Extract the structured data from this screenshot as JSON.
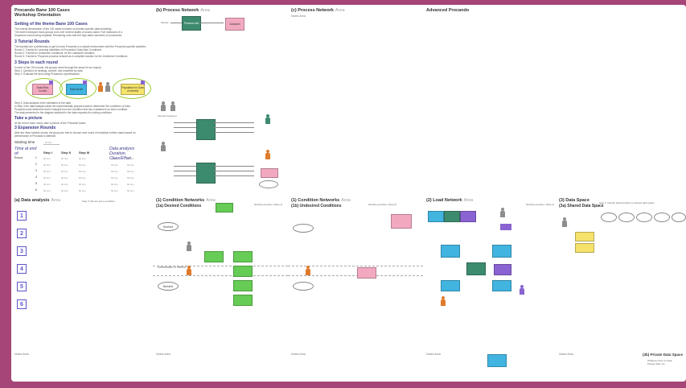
{
  "colors": {
    "frame": "#a64577",
    "board": "#e7e7ea",
    "panel": "#ffffff",
    "accent_purple": "#5c55c8",
    "blue": "#41b4e0",
    "green": "#3d8b6e",
    "lime": "#66cc55",
    "pink": "#f2a9c0",
    "yellow": "#f5e26a",
    "violet": "#8a63d2",
    "orange_person": "#e07b2c",
    "grey_person": "#8d8d8d"
  },
  "orientation": {
    "title": "Procando Bane 100 Cases",
    "subtitle": "Workshop Orientation",
    "sec1": "Setting of the theme Bane 100 Cases",
    "sec1_text": [
      "The overall demarcation of the 100 cases is based on domain-specific data modelling.",
      "The team's transport focus groups runs over several states of sound-cases. Five instances of a",
      "Sequence-card moving hospitals. Remaining rows with the high-rated outcomes of procedures."
    ],
    "sec2": "3 Tutorial Rounds",
    "sec2_text": [
      "The tutorials are a preliminary to get to know Procando in a simple environment with the Procando-specific activities.",
      "Round 1: Tutorial for Learning Identifiers of Procando's Data Nice Conditions",
      "Round 2: Tutorial for Undesired Conditions: for the undesired condition",
      "Round 3: Tutorial to Procando process network as a complete solution for the Undesired Conditions"
    ],
    "sec3": "3 Steps in each round",
    "sec3_text": [
      "In each of the 100 rounds, the groups move through the steps for an enquiry.",
      "Step 1: Question on strategy, context, and modelled by data",
      "Step 2: Evaluate the item using Procando's specifications"
    ],
    "diagram_boxes": [
      "Data Ethic Control",
      "Data Model",
      "Population for Data of Interest"
    ],
    "sec4_text": [
      "Step 3: Data analysis of the estimated or the data",
      "In Step 3 the data analysis takes the experimentally prepared data to determine the conditions of Data",
      "Procando must determine that it emerges from the condition that has a statement on each condition.",
      "The data presented in the diagram depicted in the data requests its cooling conditions."
    ],
    "sec5": "Take a picture",
    "sec5_text": "At the end of each round, take a picture of the Procando board.",
    "sec6": "3 Expansion Rounds",
    "sec6_text": [
      "After the three tutorial rounds, the group are free to choose next round of resolution further cases based on",
      "performance of Procando's attention."
    ],
    "starting_time_label": "Starting time",
    "starting_time_value": "hh:mm",
    "time_at_end": "Time at end of:",
    "step_cols": [
      "Step I",
      "Step II",
      "Step III"
    ],
    "analysis_col": "Data analysis Duration, Class/Effort",
    "round_label": "Round",
    "rounds": [
      "1",
      "2",
      "3",
      "4",
      "5",
      "6"
    ],
    "cell_placeholder": "hh:mm"
  },
  "top_panels": [
    {
      "title": "(b) Process Network",
      "note": "Area"
    },
    {
      "title": "(c) Process Network",
      "note": "Area"
    },
    {
      "title": "Advanced Procando",
      "note": ""
    }
  ],
  "bottom_panels": [
    {
      "title": "(a) Data analysis",
      "note": "Area"
    },
    {
      "title": "(1) Condition Networks",
      "note": "Area",
      "sub": "(1a) Desired Conditions"
    },
    {
      "title": "(1) Condition Networks",
      "note": "Area",
      "sub": "(1b) Undesired Conditions"
    },
    {
      "title": "(2) Load Network",
      "note": "Area",
      "sub": ""
    },
    {
      "title": "(3) Data Space",
      "note": "",
      "sub": "(3a) Shared Data Space"
    }
  ],
  "analysis_numbers": [
    "1",
    "2",
    "3",
    "4",
    "5",
    "6"
  ],
  "labels": {
    "notes_area": "Notes Area",
    "desired": "Desired",
    "demarcation": "Demarcation of interest",
    "needed": "Needed",
    "private_title": "(3b) Private Data Space",
    "private_text_1": "Whatever that, for data",
    "private_text_2": "Private data, etc.",
    "process_title": "Process",
    "internal_customer": "Internal Customer",
    "sender": "Sender",
    "customer": "Customer",
    "process_unit": "Process Unit",
    "pn_instructions": "Instructions",
    "pn_question_1": "Iterative question: (Step 1)",
    "pn_question_2": "Iterative question: (Step 2)",
    "data_analysis_note": "Step 3: We are just a condition",
    "note_side": "Step 1: Identify desired data in a shared data space"
  }
}
